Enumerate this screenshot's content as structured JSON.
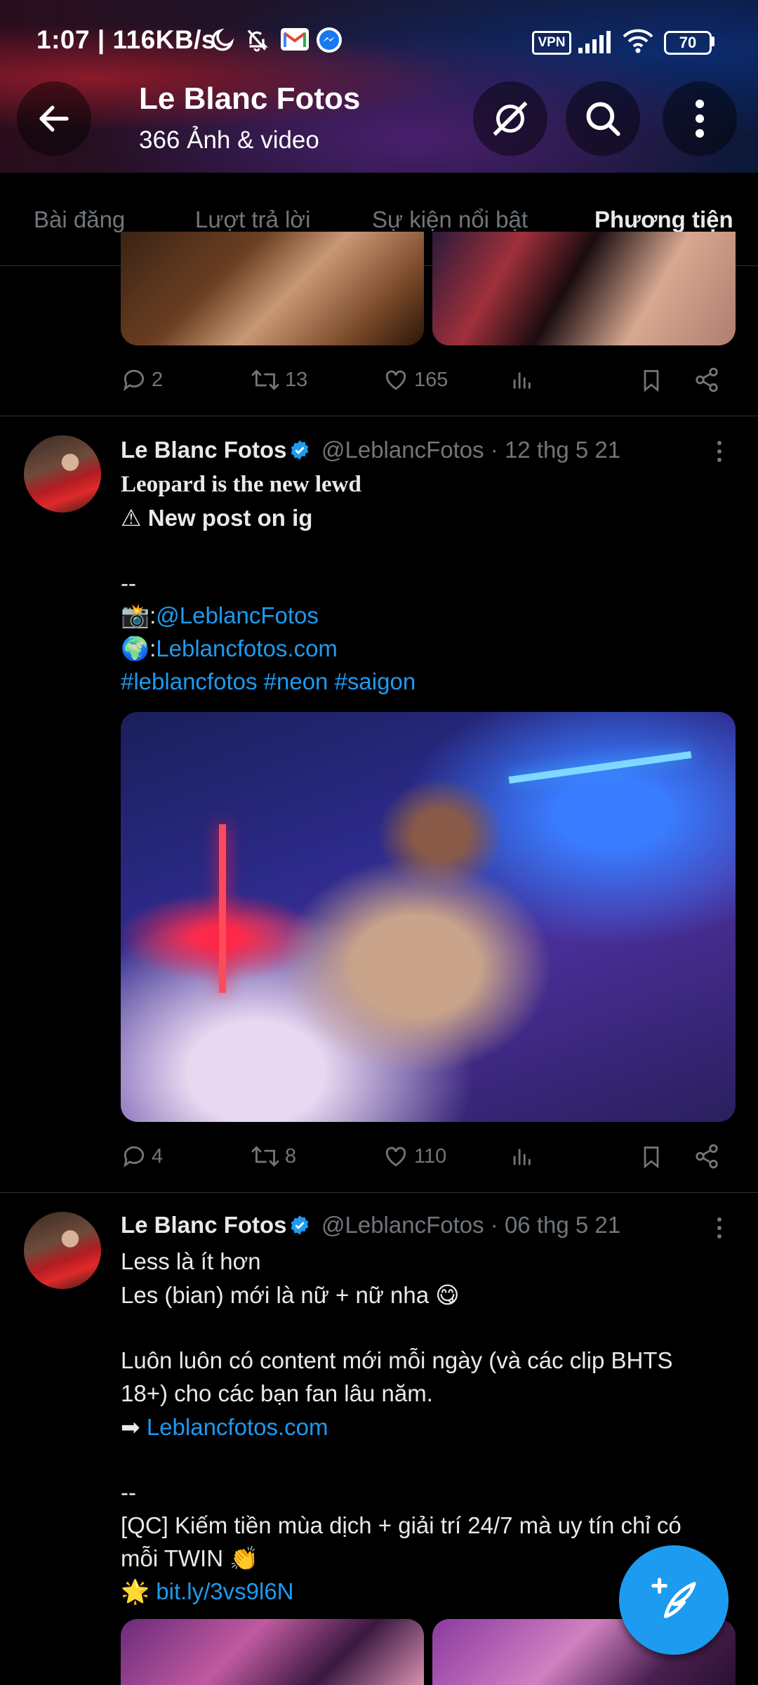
{
  "status_bar": {
    "time_speed": "1:07 | 116KB/s",
    "vpn": "VPN",
    "battery": "70"
  },
  "header": {
    "title": "Le Blanc Fotos",
    "subtitle": "366 Ảnh & video"
  },
  "tabs": [
    {
      "label": "Bài đăng"
    },
    {
      "label": "Lượt trả lời"
    },
    {
      "label": "Sự kiện nổi bật"
    },
    {
      "label": "Phương tiện"
    }
  ],
  "active_tab": "Phương tiện",
  "tweets": [
    {
      "actions": {
        "replies": "2",
        "retweets": "13",
        "likes": "165"
      }
    },
    {
      "name": "Le Blanc Fotos",
      "handle_date": "@LeblancFotos · 12 thg 5 21",
      "lines": [
        "Leopard is the new lewd",
        "⚠ New post on ig",
        "--",
        "📸:",
        "@LeblancFotos",
        "🌍:",
        "Leblancfotos.com",
        "#leblancfotos #neon #saigon"
      ],
      "actions": {
        "replies": "4",
        "retweets": "8",
        "likes": "110"
      }
    },
    {
      "name": "Le Blanc Fotos",
      "handle_date": "@LeblancFotos · 06 thg 5 21",
      "lines": [
        "Less là ít hơn",
        "Les (bian) mới là nữ + nữ nha 😋",
        "Luôn luôn có content mới mỗi ngày (và các clip BHTS",
        "18+) cho các bạn fan lâu năm.",
        "➡",
        "Leblancfotos.com",
        "--",
        "[QC] Kiếm tiền mùa dịch + giải trí 24/7 mà uy tín chỉ có",
        "mỗi TWIN 👏",
        "🌟",
        "bit.ly/3vs9l6N"
      ]
    }
  ],
  "colors": {
    "accent": "#1d9bf0",
    "muted": "#71767b",
    "text": "#e7e9ea",
    "background": "#000000"
  }
}
